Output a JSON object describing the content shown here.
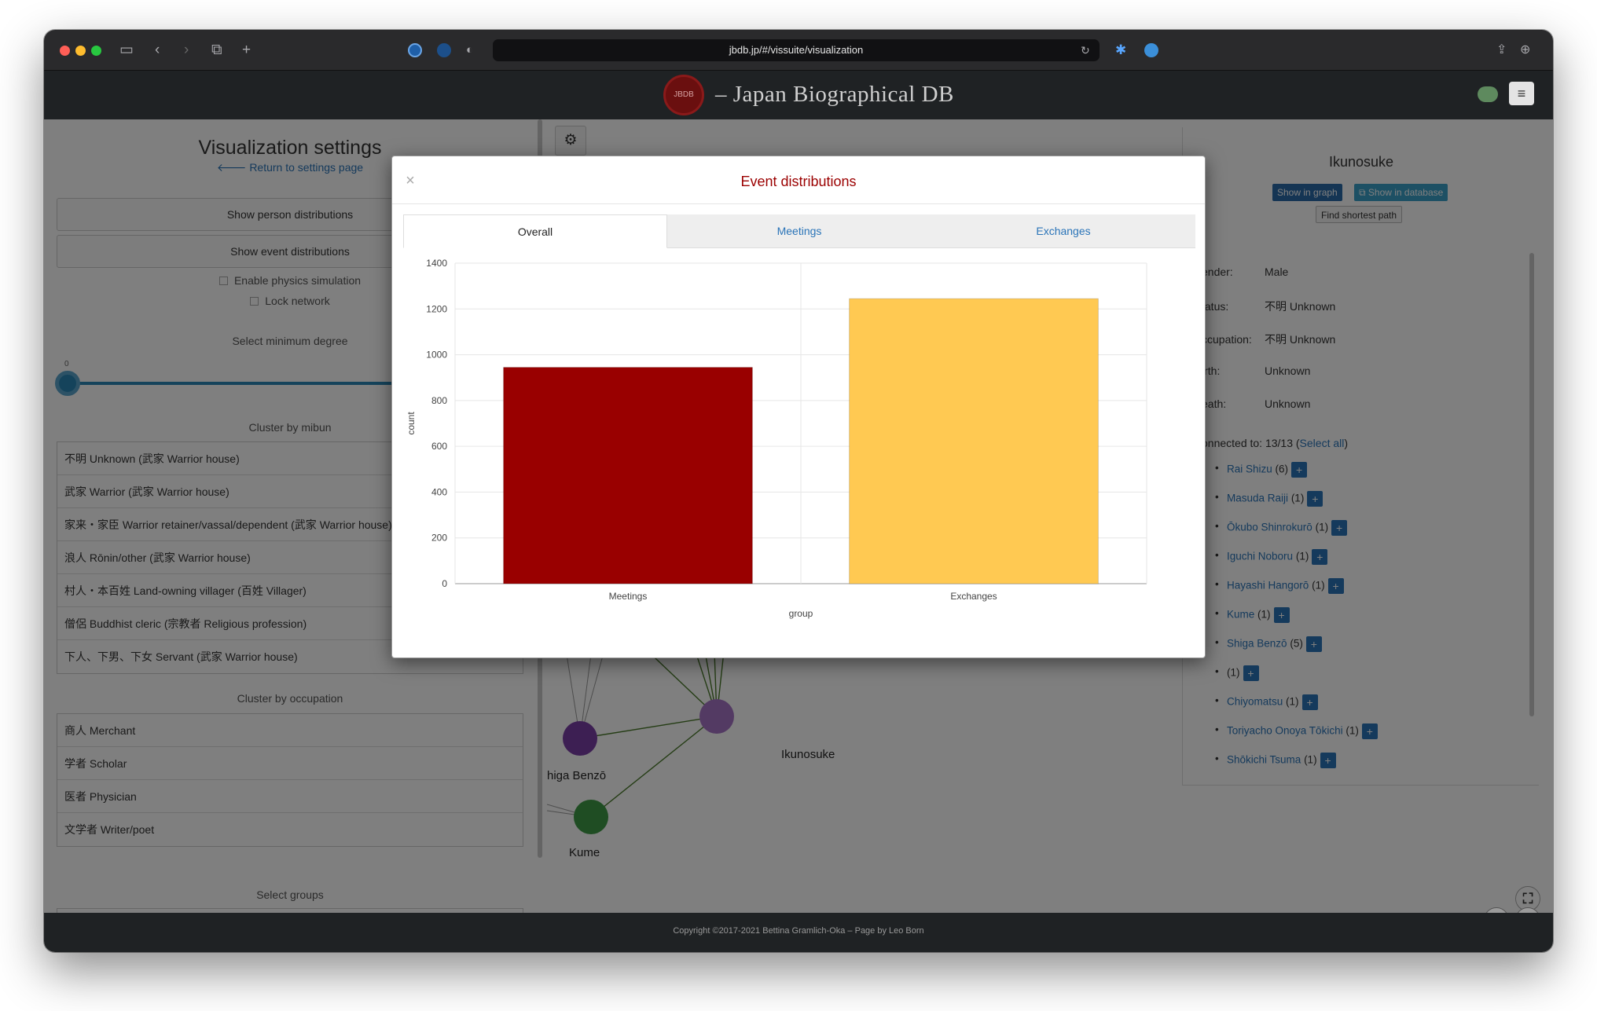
{
  "browser": {
    "url": "jbdb.jp/#/vissuite/visualization"
  },
  "app": {
    "logo_text": "JBDB",
    "brand": "– Japan Biographical DB",
    "menu_icon": "hamburger-icon"
  },
  "sidebar": {
    "title": "Visualization settings",
    "return_link": "🡐 Return to settings page",
    "person_dist_button": "Show person distributions",
    "event_dist_button": "Show event distributions",
    "physics_label": "Enable physics simulation",
    "lock_label": "Lock network",
    "min_degree_label": "Select minimum degree",
    "min_degree_value": "0",
    "mibun_heading": "Cluster by mibun",
    "mibun_items": [
      "不明 Unknown (武家 Warrior house)",
      "武家 Warrior (武家 Warrior house)",
      "家来・家臣 Warrior retainer/vassal/dependent (武家 Warrior house)",
      "浪人 Rōnin/other (武家 Warrior house)",
      "村人・本百姓 Land-owning villager (百姓 Villager)",
      "僧侶 Buddhist cleric (宗教者 Religious profession)",
      "下人、下男、下女 Servant (武家 Warrior house)"
    ],
    "occupation_heading": "Cluster by occupation",
    "occupation_items": [
      "商人 Merchant",
      "学者 Scholar",
      "医者 Physician",
      "文学者 Writer/poet"
    ],
    "groups_heading": "Select groups"
  },
  "graph": {
    "settings_icon": "gear-icon",
    "nodes": [
      {
        "label": "Ikunosuke",
        "color": "#a774c6"
      },
      {
        "label": "Shiga Benzō",
        "color": "#7a3ea6"
      },
      {
        "label": "Kume",
        "color": "#3f9a46"
      }
    ],
    "node_label_truncated": "higa Benzō"
  },
  "detail": {
    "name": "Ikunosuke",
    "show_in_graph": "Show in graph",
    "show_in_db": "Show in database",
    "find_path": "Find shortest path",
    "fields": [
      {
        "key": "ender:",
        "value": "Male"
      },
      {
        "key": "tatus:",
        "value": "不明 Unknown"
      },
      {
        "key": "ccupation:",
        "value": "不明 Unknown"
      },
      {
        "key": "irth:",
        "value": "Unknown"
      },
      {
        "key": "eath:",
        "value": "Unknown"
      }
    ],
    "connected_prefix": "onnected to: 13/13 (",
    "select_all": "Select all",
    "connected_suffix": ")",
    "connections": [
      {
        "name": "Rai Shizu",
        "count": "(6)"
      },
      {
        "name": "Masuda Raiji",
        "count": "(1)"
      },
      {
        "name": "Ōkubo Shinrokurō",
        "count": "(1)"
      },
      {
        "name": "Iguchi Noboru",
        "count": "(1)"
      },
      {
        "name": "Hayashi Hangorō",
        "count": "(1)"
      },
      {
        "name": "Kume",
        "count": "(1)"
      },
      {
        "name": "Shiga Benzō",
        "count": "(5)"
      },
      {
        "name": "",
        "count": "(1)"
      },
      {
        "name": "Chiyomatsu",
        "count": "(1)"
      },
      {
        "name": "Toriyacho Onoya Tōkichi",
        "count": "(1)"
      },
      {
        "name": "Shōkichi Tsuma",
        "count": "(1)"
      }
    ],
    "plus_symbol": "+"
  },
  "footer": {
    "text": "Copyright ©2017-2021 Bettina Gramlich-Oka – Page by Leo Born"
  },
  "modal": {
    "title": "Event distributions",
    "close": "×",
    "tabs": [
      {
        "label": "Overall",
        "active": true
      },
      {
        "label": "Meetings",
        "active": false
      },
      {
        "label": "Exchanges",
        "active": false
      }
    ]
  },
  "chart_data": {
    "type": "bar",
    "categories": [
      "Meetings",
      "Exchanges"
    ],
    "values": [
      945,
      1245
    ],
    "colors": [
      "#990000",
      "#ffc952"
    ],
    "title": "",
    "xlabel": "group",
    "ylabel": "count",
    "ylim": [
      0,
      1400
    ],
    "yticks": [
      0,
      200,
      400,
      600,
      800,
      1000,
      1200,
      1400
    ],
    "grid": true,
    "legend": "none"
  },
  "zoom": {
    "fit_icon": "fit-screen-icon",
    "minus": "−",
    "plus": "+"
  }
}
